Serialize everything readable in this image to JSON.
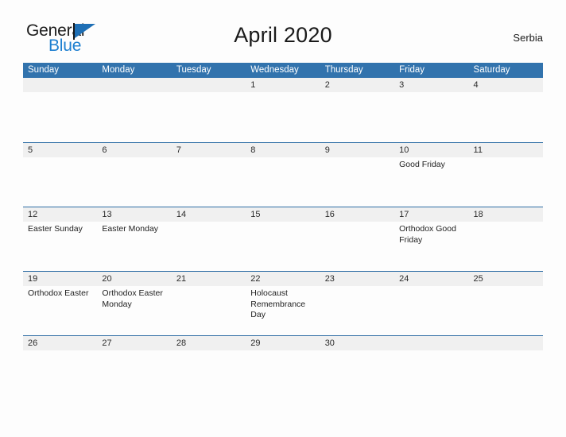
{
  "brand": {
    "line1": "General",
    "line2": "Blue",
    "triangle_color": "#1e6fb5",
    "text_color": "#1d1d1d",
    "blue_color": "#1d7fd0"
  },
  "header": {
    "title": "April 2020",
    "country": "Serbia"
  },
  "theme": {
    "header_bar": "#3273ad",
    "row_line": "#2e6da4",
    "day_band": "#f0f0f0",
    "page_background": "#fdfdfd"
  },
  "calendar": {
    "weekdays": [
      "Sunday",
      "Monday",
      "Tuesday",
      "Wednesday",
      "Thursday",
      "Friday",
      "Saturday"
    ],
    "weeks": [
      {
        "days": [
          {
            "num": "",
            "event": ""
          },
          {
            "num": "",
            "event": ""
          },
          {
            "num": "",
            "event": ""
          },
          {
            "num": "1",
            "event": ""
          },
          {
            "num": "2",
            "event": ""
          },
          {
            "num": "3",
            "event": ""
          },
          {
            "num": "4",
            "event": ""
          }
        ]
      },
      {
        "days": [
          {
            "num": "5",
            "event": ""
          },
          {
            "num": "6",
            "event": ""
          },
          {
            "num": "7",
            "event": ""
          },
          {
            "num": "8",
            "event": ""
          },
          {
            "num": "9",
            "event": ""
          },
          {
            "num": "10",
            "event": "Good Friday"
          },
          {
            "num": "11",
            "event": ""
          }
        ]
      },
      {
        "days": [
          {
            "num": "12",
            "event": "Easter Sunday"
          },
          {
            "num": "13",
            "event": "Easter Monday"
          },
          {
            "num": "14",
            "event": ""
          },
          {
            "num": "15",
            "event": ""
          },
          {
            "num": "16",
            "event": ""
          },
          {
            "num": "17",
            "event": "Orthodox Good Friday"
          },
          {
            "num": "18",
            "event": ""
          }
        ]
      },
      {
        "days": [
          {
            "num": "19",
            "event": "Orthodox Easter"
          },
          {
            "num": "20",
            "event": "Orthodox Easter Monday"
          },
          {
            "num": "21",
            "event": ""
          },
          {
            "num": "22",
            "event": "Holocaust Remembrance Day"
          },
          {
            "num": "23",
            "event": ""
          },
          {
            "num": "24",
            "event": ""
          },
          {
            "num": "25",
            "event": ""
          }
        ]
      },
      {
        "days": [
          {
            "num": "26",
            "event": ""
          },
          {
            "num": "27",
            "event": ""
          },
          {
            "num": "28",
            "event": ""
          },
          {
            "num": "29",
            "event": ""
          },
          {
            "num": "30",
            "event": ""
          },
          {
            "num": "",
            "event": ""
          },
          {
            "num": "",
            "event": ""
          }
        ]
      }
    ]
  }
}
